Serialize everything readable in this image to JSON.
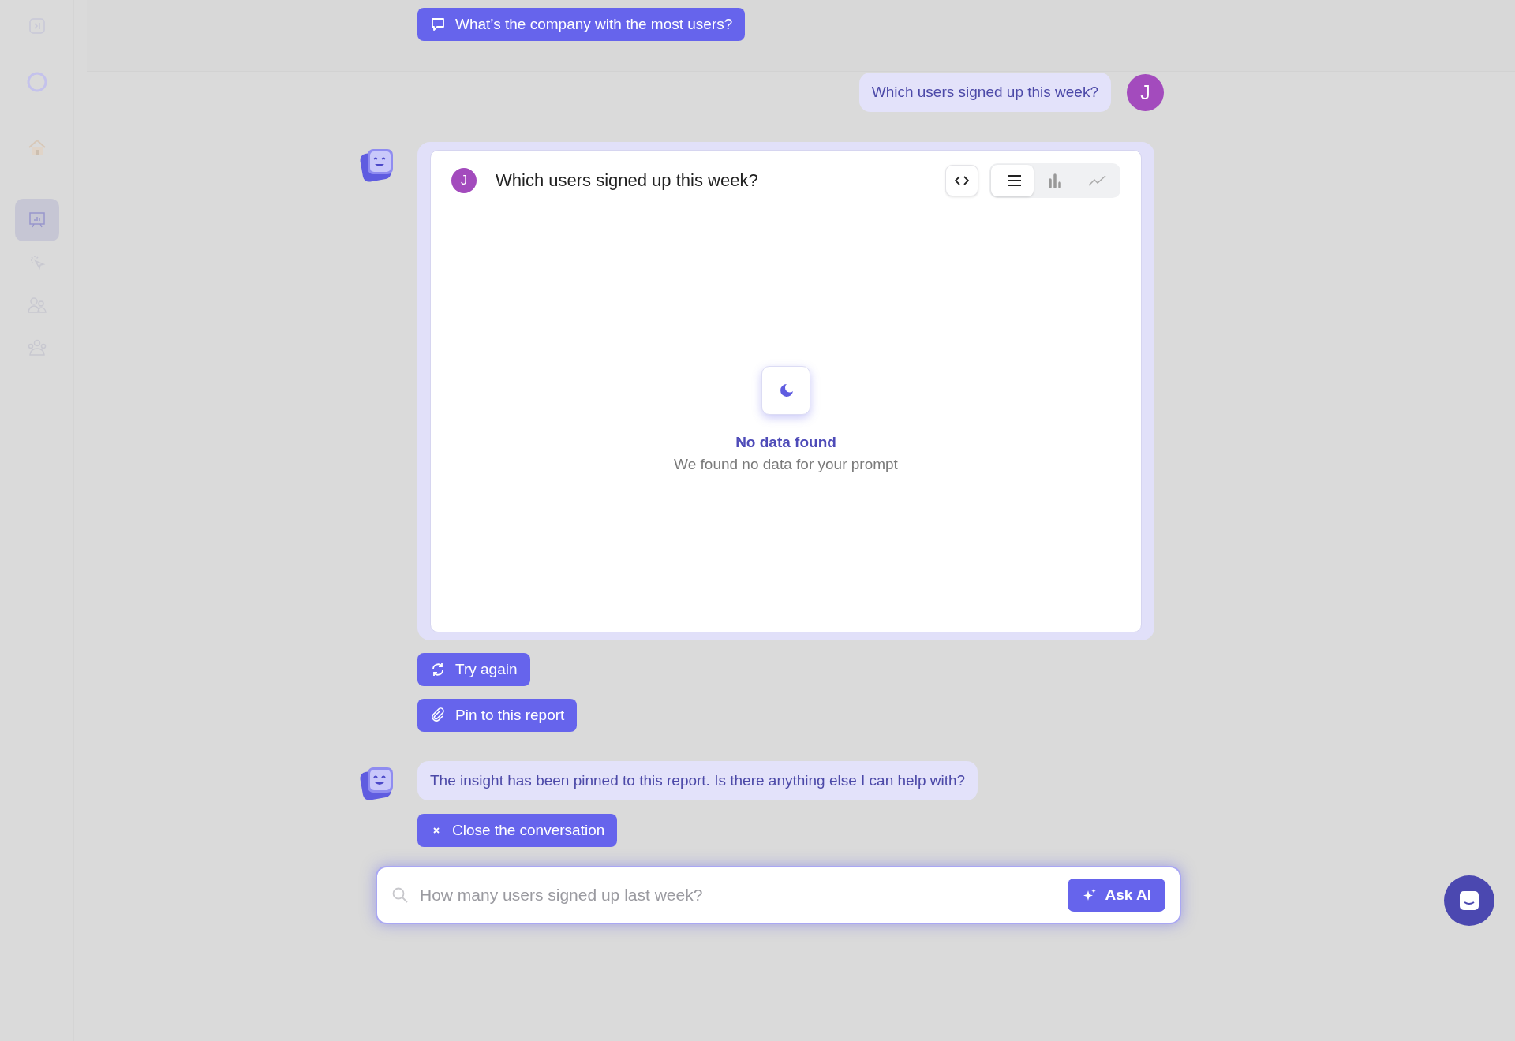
{
  "sidebar": {
    "items": [
      {
        "kind": "collapse",
        "selected": false
      },
      {
        "kind": "status",
        "selected": false
      },
      {
        "kind": "home",
        "selected": false
      },
      {
        "kind": "reports",
        "selected": true
      },
      {
        "kind": "events",
        "selected": false
      },
      {
        "kind": "people",
        "selected": false
      },
      {
        "kind": "groups",
        "selected": false
      }
    ]
  },
  "chat": {
    "suggestion": "What’s the company with the most users?",
    "user_message": {
      "text": "Which users signed up this week?",
      "avatar": "J"
    },
    "result_card": {
      "avatar": "J",
      "question": "Which users signed up this week?",
      "views": [
        {
          "kind": "list",
          "selected": true
        },
        {
          "kind": "bar",
          "selected": false
        },
        {
          "kind": "line",
          "selected": false
        }
      ],
      "empty_title": "No data found",
      "empty_text": "We found no data for your prompt"
    },
    "actions": [
      {
        "kind": "retry",
        "label": "Try again"
      },
      {
        "kind": "pin",
        "label": "Pin to this report"
      }
    ],
    "bot_message": "The insight has been pinned to this report. Is there anything else I can help with?",
    "close_action": "Close the conversation",
    "input": {
      "placeholder": "How many users signed up last week?",
      "button": "Ask AI"
    }
  }
}
